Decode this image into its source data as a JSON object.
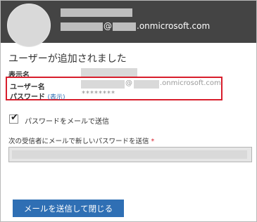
{
  "header": {
    "email_at": "@",
    "email_domain": ".onmicrosoft.com"
  },
  "title": "ユーザーが追加されました",
  "fields": {
    "display_name_label": "表示名",
    "username_label": "ユーザー名",
    "username_at": "@",
    "username_domain": ".onmicrosoft.com",
    "password_label": "パスワード",
    "show_link": "(表示)",
    "password_value": "********"
  },
  "email_option": {
    "checkbox_label": "パスワードをメールで送信",
    "checked": true,
    "recipients_label": "次の受信者にメールで新しいパスワードを送信",
    "required_mark": "*"
  },
  "actions": {
    "send_close": "メールを送信して閉じる"
  },
  "colors": {
    "header_bg": "#444444",
    "highlight_box": "#d81e2c",
    "primary_button": "#2f6fb4",
    "link": "#2d6fb4"
  }
}
